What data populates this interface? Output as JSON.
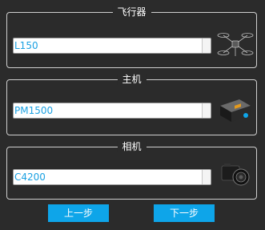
{
  "aircraft": {
    "title": "飞行器",
    "selected": "L150",
    "image_icon": "drone-icon"
  },
  "host": {
    "title": "主机",
    "selected": "PM1500",
    "image_icon": "host-device-icon"
  },
  "camera": {
    "title": "相机",
    "selected": "C4200",
    "image_icon": "camera-icon"
  },
  "buttons": {
    "prev_label": "上一步",
    "next_label": "下一步"
  },
  "colors": {
    "accent": "#0ea5e9",
    "value_text": "#1ba1e2",
    "background": "#2b2b2b"
  }
}
